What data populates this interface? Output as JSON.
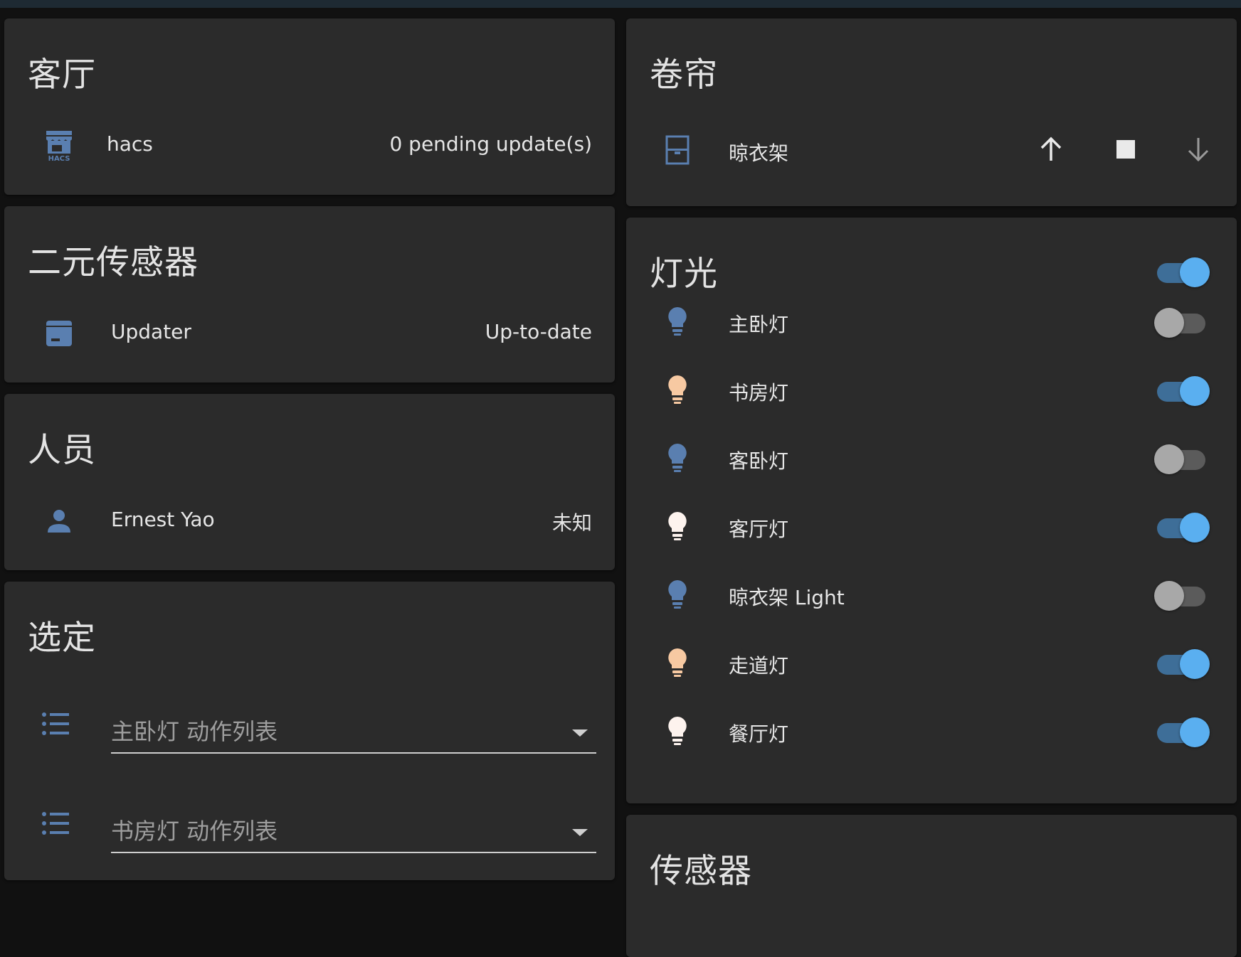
{
  "colors": {
    "background": "#111111",
    "card": "#2b2b2b",
    "icon_blue": "#5a7fb0",
    "toggle_on": "#5aaff0",
    "bulb_warm": "#f7c9a2",
    "bulb_white": "#fdf3ee"
  },
  "living_room": {
    "title": "客厅",
    "rows": [
      {
        "icon": "hacs-icon",
        "name": "hacs",
        "state": "0 pending update(s)"
      }
    ]
  },
  "binary_sensor": {
    "title": "二元传感器",
    "rows": [
      {
        "icon": "package-icon",
        "name": "Updater",
        "state": "Up-to-date"
      }
    ]
  },
  "person": {
    "title": "人员",
    "rows": [
      {
        "icon": "account-icon",
        "name": "Ernest Yao",
        "state": "未知"
      }
    ]
  },
  "select": {
    "title": "选定",
    "items": [
      {
        "icon": "format-list-bulleted-icon",
        "value": "主卧灯 动作列表"
      },
      {
        "icon": "format-list-bulleted-icon",
        "value": "书房灯 动作列表"
      }
    ]
  },
  "cover": {
    "title": "卷帘",
    "rows": [
      {
        "icon": "window-shutter-icon",
        "name": "晾衣架",
        "controls": [
          "arrow-up-icon",
          "stop-icon",
          "arrow-down-icon"
        ]
      }
    ]
  },
  "light": {
    "title": "灯光",
    "all_on": true,
    "rows": [
      {
        "name": "主卧灯",
        "on": false,
        "bulb": "lightbulb-icon",
        "color": "#5a7fb0"
      },
      {
        "name": "书房灯",
        "on": true,
        "bulb": "lightbulb-icon",
        "color": "#f7c9a2"
      },
      {
        "name": "客卧灯",
        "on": false,
        "bulb": "lightbulb-icon",
        "color": "#5a7fb0"
      },
      {
        "name": "客厅灯",
        "on": true,
        "bulb": "lightbulb-icon",
        "color": "#fdf3ee"
      },
      {
        "name": "晾衣架 Light",
        "on": false,
        "bulb": "lightbulb-icon",
        "color": "#5a7fb0"
      },
      {
        "name": "走道灯",
        "on": true,
        "bulb": "lightbulb-icon",
        "color": "#f7c9a2"
      },
      {
        "name": "餐厅灯",
        "on": true,
        "bulb": "lightbulb-icon",
        "color": "#fdf3ee"
      }
    ]
  },
  "sensor": {
    "title": "传感器"
  }
}
